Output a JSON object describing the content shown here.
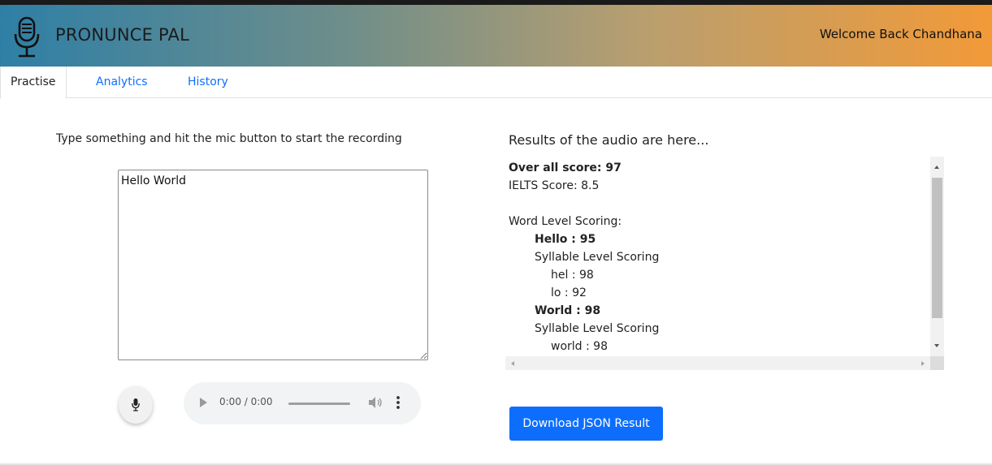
{
  "header": {
    "app_title": "PRONUNCE PAL",
    "welcome": "Welcome Back Chandhana",
    "logo_icon": "microphone-icon"
  },
  "tabs": [
    {
      "label": "Practise",
      "active": true
    },
    {
      "label": "Analytics",
      "active": false
    },
    {
      "label": "History",
      "active": false
    }
  ],
  "practise": {
    "instruction": "Type something and hit the mic button to start the recording",
    "input_value": "Hello World",
    "mic_icon": "microphone-icon",
    "audio": {
      "time": "0:00 / 0:00"
    }
  },
  "results": {
    "title": "Results of the audio are here...",
    "overall": "Over all score: 97",
    "ielts": "IELTS Score: 8.5",
    "word_level_heading": "Word Level Scoring:",
    "words": [
      {
        "word": "Hello : 95",
        "syllable_heading": "Syllable Level Scoring",
        "syllables": [
          "hel : 98",
          "lo : 92"
        ]
      },
      {
        "word": "World : 98",
        "syllable_heading": "Syllable Level Scoring",
        "syllables": [
          "world : 98"
        ]
      }
    ],
    "download_label": "Download JSON Result"
  },
  "colors": {
    "accent": "#0d6efd",
    "header_gradient_start": "#2e7fa6",
    "header_gradient_end": "#f29a38"
  }
}
